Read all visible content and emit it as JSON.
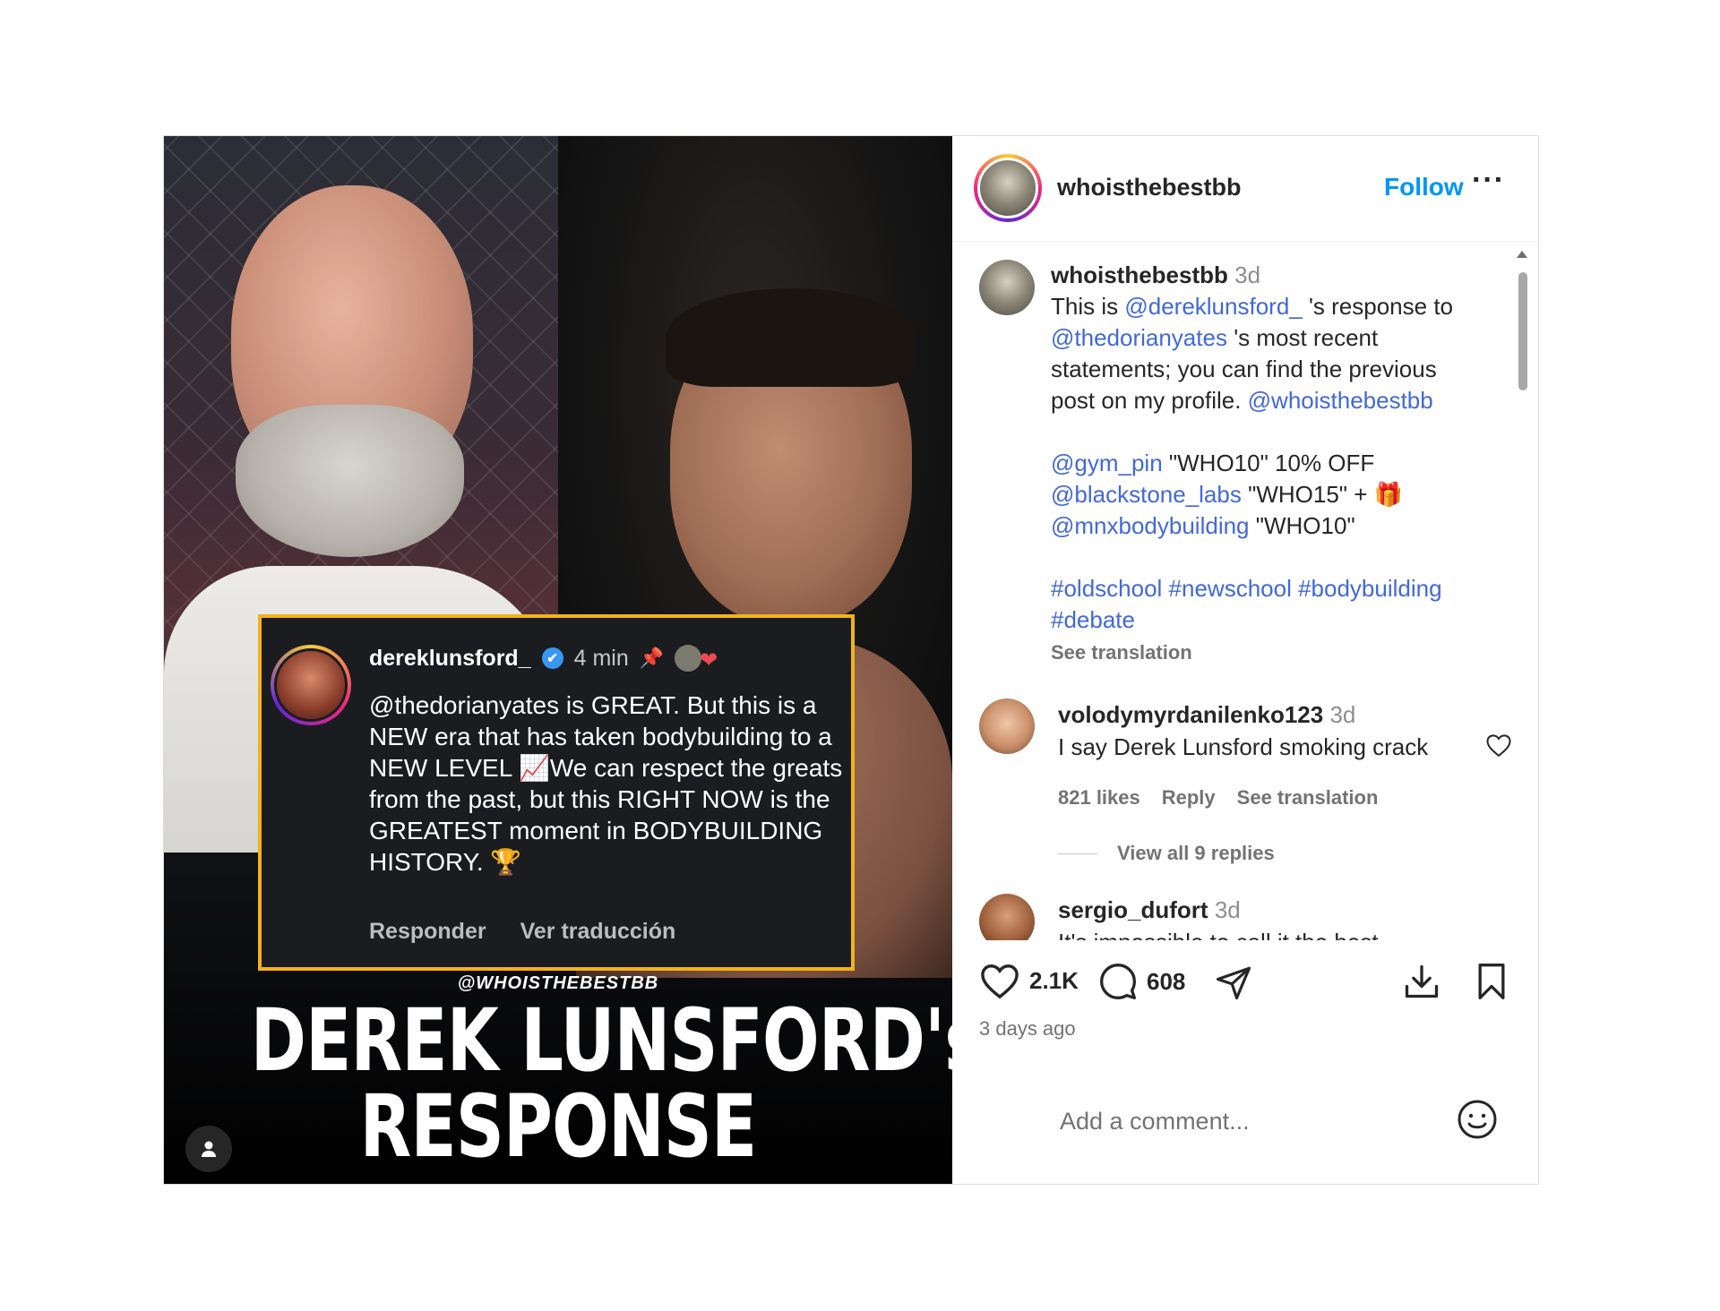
{
  "post": {
    "media": {
      "overlay_comment": {
        "username": "dereklunsford_",
        "verified_glyph": "✔",
        "time": "4 min",
        "pin_glyph": "📌",
        "heart_glyph": "❤",
        "text": "@thedorianyates is GREAT. But this is a NEW era that has taken bodybuilding to a NEW LEVEL 📈We can respect the greats from the past, but this RIGHT NOW is the GREATEST moment in BODYBUILDING HISTORY. 🏆",
        "reply_label": "Responder",
        "translate_label": "Ver traducción"
      },
      "watermark": "@WHOISTHEBESTBB",
      "headline_line1": "DEREK LUNSFORD's",
      "headline_line2": "RESPONSE",
      "tag_icon": "person-icon"
    },
    "header": {
      "username": "whoisthebestbb",
      "follow_label": "Follow",
      "more_label": "···"
    },
    "caption": {
      "username": "whoisthebestbb",
      "time": "3d",
      "text_prefix": "This is ",
      "mention1": "@dereklunsford_",
      "text_mid1": " 's response to ",
      "mention2": "@thedorianyates",
      "text_mid2": " 's most recent statements; you can find the previous post on my profile. ",
      "mention3": "@whoisthebestbb",
      "promo1_handle": "@gym_pin",
      "promo1_text": " \"WHO10\" 10% OFF",
      "promo2_handle": "@blackstone_labs",
      "promo2_text": " \"WHO15\" + 🎁",
      "promo3_handle": "@mnxbodybuilding",
      "promo3_text": " \"WHO10\"",
      "hashtags": "#oldschool #newschool #bodybuilding #debate",
      "see_translation": "See translation"
    },
    "comments": [
      {
        "username": "volodymyrdanilenko123",
        "time": "3d",
        "text": "I say Derek Lunsford smoking crack",
        "likes": "821 likes",
        "reply_label": "Reply",
        "translate_label": "See translation",
        "view_replies": "View all 9 replies"
      },
      {
        "username": "sergio_dufort",
        "time": "3d",
        "text": "It's impossible to call it the best"
      }
    ],
    "actions": {
      "like_count": "2.1K",
      "comment_count": "608",
      "posted": "3 days ago"
    },
    "add_comment": {
      "placeholder": "Add a comment..."
    }
  },
  "colors": {
    "link": "#4169d6",
    "follow": "#0095f6",
    "card_border": "#f2b21c"
  }
}
